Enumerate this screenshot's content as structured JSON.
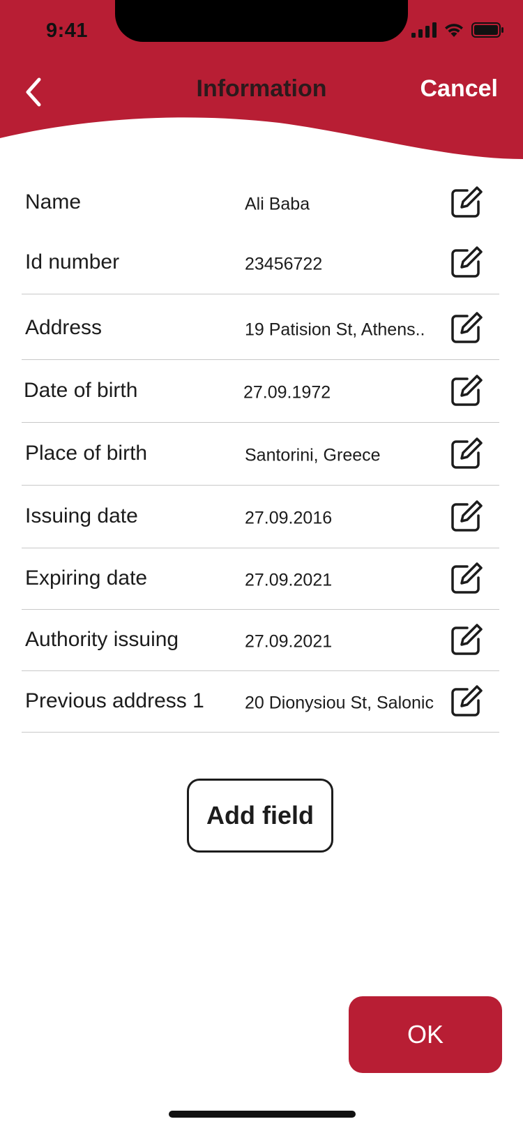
{
  "status_bar": {
    "time": "9:41",
    "icons": [
      "signal-icon",
      "wifi-icon",
      "battery-icon"
    ]
  },
  "header": {
    "title": "Information",
    "cancel_label": "Cancel",
    "back_icon": "chevron-left-icon",
    "background_color": "#b81e34"
  },
  "fields": [
    {
      "label": "Name",
      "value": "Ali Baba",
      "edit_icon": "edit-icon"
    },
    {
      "label": "Id number",
      "value": "23456722",
      "edit_icon": "edit-icon"
    },
    {
      "label": "Address",
      "value": "19 Patision St, Athens..",
      "edit_icon": "edit-icon"
    },
    {
      "label": "Date of birth",
      "value": "27.09.1972",
      "edit_icon": "edit-icon"
    },
    {
      "label": "Place of birth",
      "value": "Santorini, Greece",
      "edit_icon": "edit-icon"
    },
    {
      "label": "Issuing date",
      "value": "27.09.2016",
      "edit_icon": "edit-icon"
    },
    {
      "label": "Expiring date",
      "value": "27.09.2021",
      "edit_icon": "edit-icon"
    },
    {
      "label": "Authority issuing",
      "value": "27.09.2021",
      "edit_icon": "edit-icon"
    },
    {
      "label": "Previous address 1",
      "value": "20 Dionysiou St, Salonic",
      "edit_icon": "edit-icon"
    }
  ],
  "actions": {
    "add_field_label": "Add field",
    "ok_label": "OK",
    "accent_color": "#b81e34"
  }
}
